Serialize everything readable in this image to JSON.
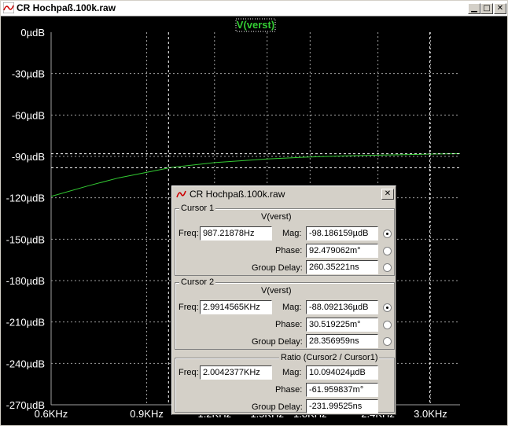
{
  "window": {
    "title": "CR Hochpaß.100k.raw"
  },
  "plot": {
    "trace_label": "V(verst)",
    "y_ticks": [
      "0µdB",
      "-30µdB",
      "-60µdB",
      "-90µdB",
      "-120µdB",
      "-150µdB",
      "-180µdB",
      "-210µdB",
      "-240µdB",
      "-270µdB"
    ],
    "x_ticks": [
      "0.6KHz",
      "0.9KHz",
      "1.2KHz",
      "1.5KHz",
      "1.8KHz",
      "2.4KHz",
      "3.0KHz"
    ],
    "colors": {
      "background": "#000000",
      "trace": "#33cc33",
      "grid": "#a0a0a0",
      "cursor": "#ffffff",
      "text": "#ffffff"
    }
  },
  "chart_data": {
    "type": "line",
    "x_scale": "log",
    "xlim": [
      600,
      3400
    ],
    "ylim": [
      -270,
      0
    ],
    "y_unit": "µdB",
    "grid": true,
    "series": [
      {
        "name": "V(verst)",
        "x": [
          600,
          700,
          800,
          900,
          1000,
          1200,
          1500,
          1800,
          2100,
          2400,
          2700,
          3000,
          3400
        ],
        "y": [
          -119,
          -111.5,
          -105.5,
          -101.5,
          -98,
          -94.5,
          -91.8,
          -90.4,
          -89.6,
          -89.1,
          -88.7,
          -88.3,
          -88.0
        ]
      }
    ],
    "cursors": [
      {
        "freq": 987.21878,
        "mag": -98.186159
      },
      {
        "freq": 2991.4565,
        "mag": -88.092136
      }
    ]
  },
  "dialog": {
    "title": "CR Hochpaß.100k.raw",
    "cursor1": {
      "label": "Cursor 1",
      "trace": "V(verst)",
      "freq_label": "Freq:",
      "freq": "987.21878Hz",
      "mag_label": "Mag:",
      "mag": "-98.186159µdB",
      "phase_label": "Phase:",
      "phase": "92.479062m°",
      "gd_label": "Group Delay:",
      "gd": "260.35221ns"
    },
    "cursor2": {
      "label": "Cursor 2",
      "trace": "V(verst)",
      "freq_label": "Freq:",
      "freq": "2.9914565KHz",
      "mag_label": "Mag:",
      "mag": "-88.092136µdB",
      "phase_label": "Phase:",
      "phase": "30.519225m°",
      "gd_label": "Group Delay:",
      "gd": "28.356959ns"
    },
    "ratio": {
      "label": "Ratio (Cursor2 / Cursor1)",
      "freq_label": "Freq:",
      "freq": "2.0042377KHz",
      "mag_label": "Mag:",
      "mag": "10.094024µdB",
      "phase_label": "Phase:",
      "phase": "-61.959837m°",
      "gd_label": "Group Delay:",
      "gd": "-231.99525ns"
    }
  }
}
